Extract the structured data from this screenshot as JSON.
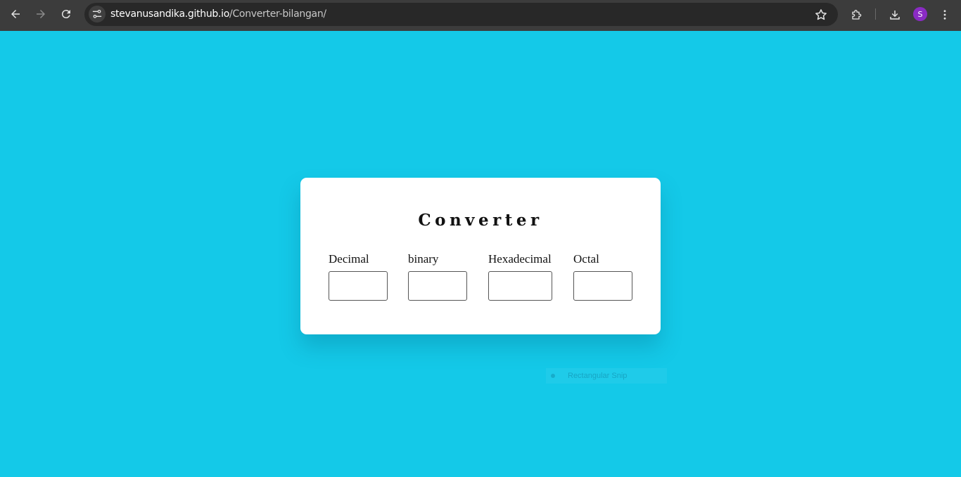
{
  "browser": {
    "url_host": "stevanusandika.github.io",
    "url_path": "/Converter-bilangan/",
    "profile_initial": "S",
    "icons": [
      "back-arrow-icon",
      "forward-arrow-icon",
      "reload-icon",
      "site-settings-icon",
      "bookmark-star-icon",
      "extensions-icon",
      "download-icon",
      "more-vert-icon"
    ]
  },
  "page": {
    "background_color": "#14c9e8",
    "title": "Converter",
    "fields": [
      {
        "label": "Decimal",
        "value": ""
      },
      {
        "label": "binary",
        "value": ""
      },
      {
        "label": "Hexadecimal",
        "value": ""
      },
      {
        "label": "Octal",
        "value": ""
      }
    ]
  },
  "overlay": {
    "snip_label": "Rectangular Snip"
  }
}
